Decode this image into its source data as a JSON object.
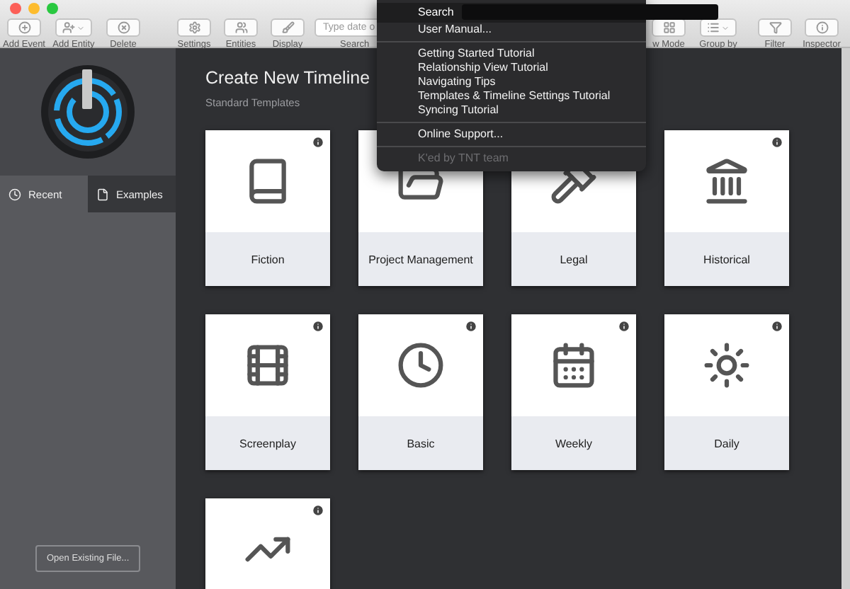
{
  "toolbar": {
    "left": [
      {
        "label": "Add Event"
      },
      {
        "label": "Add Entity"
      },
      {
        "label": "Delete"
      }
    ],
    "middle": [
      {
        "label": "Settings"
      },
      {
        "label": "Entities"
      },
      {
        "label": "Display"
      }
    ],
    "search": {
      "placeholder": "Type date o",
      "label": "Search"
    },
    "right": [
      {
        "label": "w Mode"
      },
      {
        "label": "Group by"
      }
    ],
    "far_right": [
      {
        "label": "Filter"
      },
      {
        "label": "Inspector"
      }
    ]
  },
  "help_menu": {
    "search_label": "Search",
    "items": [
      {
        "kind": "item",
        "label": "User Manual...",
        "disabled": false
      },
      {
        "kind": "separator"
      },
      {
        "kind": "item",
        "label": "Getting Started Tutorial",
        "disabled": false
      },
      {
        "kind": "item",
        "label": "Relationship View Tutorial",
        "disabled": false
      },
      {
        "kind": "item",
        "label": "Navigating Tips",
        "disabled": false
      },
      {
        "kind": "item",
        "label": "Templates & Timeline Settings Tutorial",
        "disabled": false
      },
      {
        "kind": "item",
        "label": "Syncing Tutorial",
        "disabled": false
      },
      {
        "kind": "separator"
      },
      {
        "kind": "item",
        "label": "Online Support...",
        "disabled": false
      },
      {
        "kind": "separator"
      },
      {
        "kind": "item",
        "label": "K'ed by TNT team",
        "disabled": true
      }
    ]
  },
  "sidebar": {
    "tabs": [
      {
        "label": "Recent",
        "selected": true
      },
      {
        "label": "Examples",
        "selected": false
      }
    ],
    "open_button": "Open Existing File..."
  },
  "main": {
    "title": "Create New Timeline",
    "subtitle": "Standard Templates",
    "templates": [
      {
        "kind": "full",
        "label": "Fiction"
      },
      {
        "kind": "plain",
        "label": "Project Management"
      },
      {
        "kind": "plain",
        "label": "Legal"
      },
      {
        "kind": "full",
        "label": "Historical"
      },
      {
        "kind": "full",
        "label": "Screenplay"
      },
      {
        "kind": "full",
        "label": "Basic"
      },
      {
        "kind": "full",
        "label": "Weekly"
      },
      {
        "kind": "full",
        "label": "Daily"
      },
      {
        "kind": "cut"
      }
    ]
  }
}
